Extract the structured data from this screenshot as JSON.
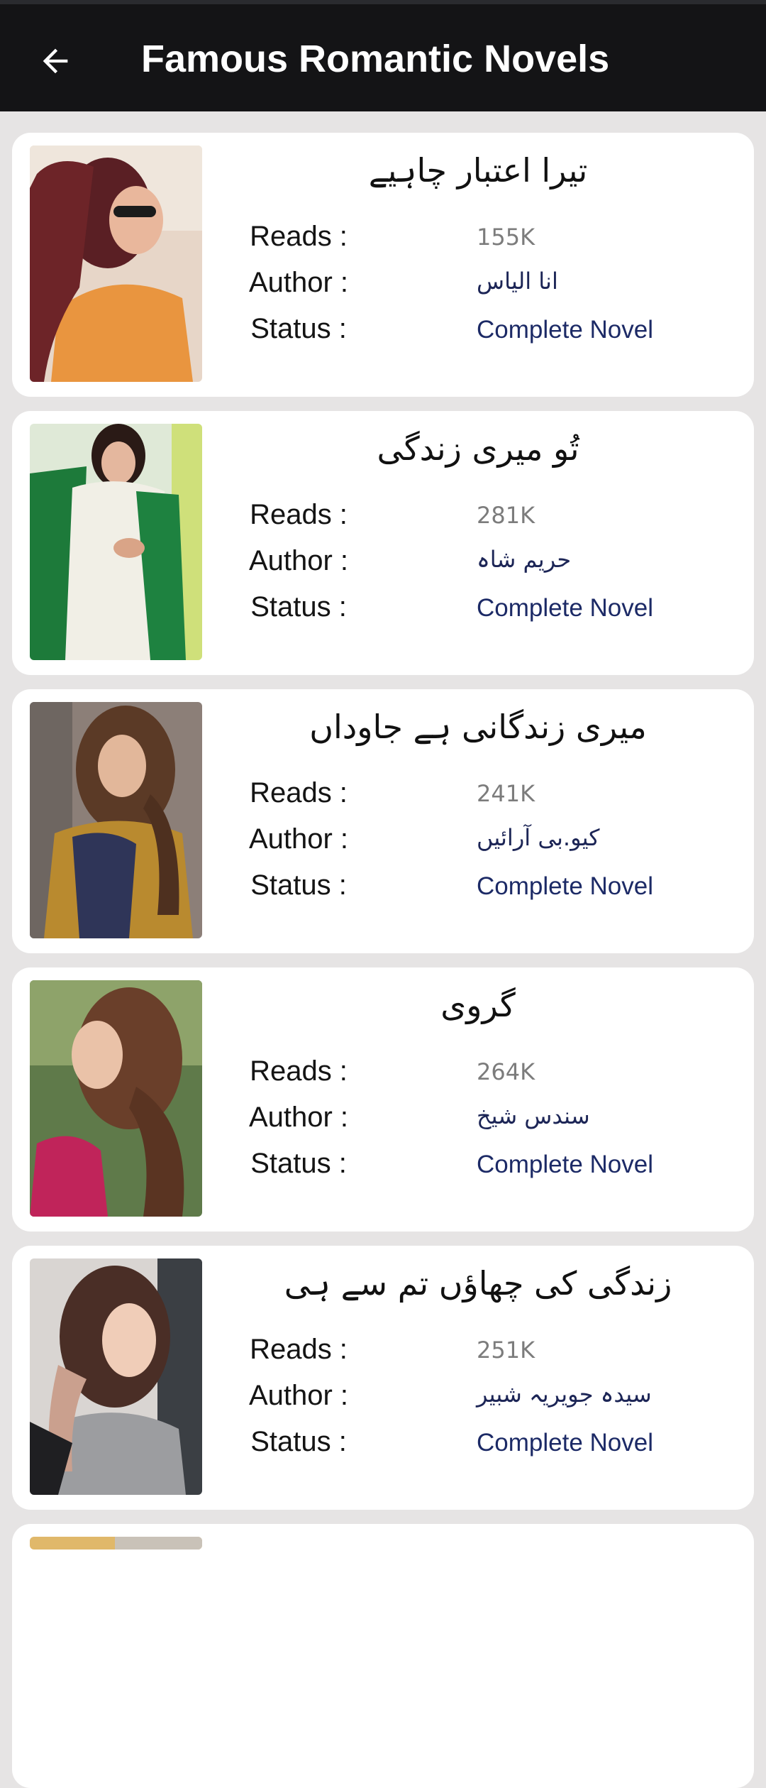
{
  "app_bar": {
    "title": "Famous Romantic Novels",
    "back_icon": "arrow-left-icon"
  },
  "labels": {
    "reads": "Reads :",
    "author": "Author :",
    "status": "Status :"
  },
  "colors": {
    "app_bar": "#141416",
    "background": "#e6e4e4",
    "card": "#ffffff",
    "status_text": "#1c2a66"
  },
  "novels": [
    {
      "title": "تیرا اعتبار چاہیے",
      "reads": "155K",
      "author": "انا الیاس",
      "status": "Complete Novel"
    },
    {
      "title": "تُو میری زندگی",
      "reads": "281K",
      "author": "حریم شاہ",
      "status": "Complete Novel"
    },
    {
      "title": "میری زندگانی ہے جاوداں",
      "reads": "241K",
      "author": "کیو.بی آرائیں",
      "status": "Complete Novel"
    },
    {
      "title": "گروی",
      "reads": "264K",
      "author": "سندس شیخ",
      "status": "Complete Novel"
    },
    {
      "title": "زندگی کی چھاؤں تم سے ہی",
      "reads": "251K",
      "author": "سیدہ جویریہ شبیر",
      "status": "Complete Novel"
    }
  ]
}
